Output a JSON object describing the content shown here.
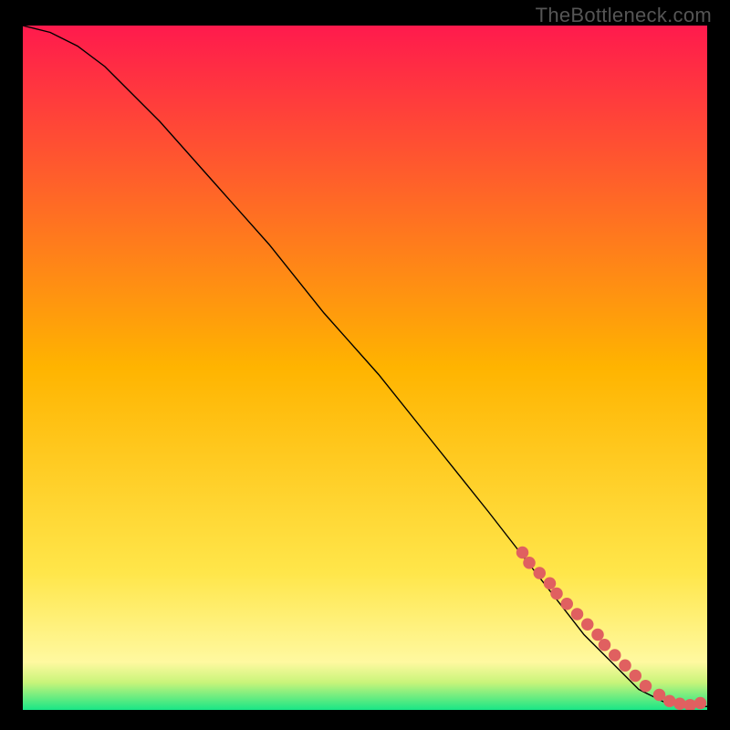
{
  "watermark": "TheBottleneck.com",
  "chart_data": {
    "type": "line",
    "title": "",
    "xlabel": "",
    "ylabel": "",
    "xlim": [
      0,
      100
    ],
    "ylim": [
      0,
      100
    ],
    "background_gradient": {
      "stops": [
        {
          "t": 0.0,
          "color": "#ff1a4d"
        },
        {
          "t": 0.5,
          "color": "#ffb400"
        },
        {
          "t": 0.8,
          "color": "#ffe64a"
        },
        {
          "t": 0.93,
          "color": "#fff9a0"
        },
        {
          "t": 0.96,
          "color": "#c8f47a"
        },
        {
          "t": 1.0,
          "color": "#19e686"
        }
      ]
    },
    "series": [
      {
        "name": "curve",
        "type": "line",
        "color": "#000000",
        "x": [
          0,
          4,
          8,
          12,
          16,
          20,
          28,
          36,
          44,
          52,
          60,
          68,
          75,
          82,
          86,
          90,
          94,
          97,
          100
        ],
        "y": [
          100,
          99,
          97,
          94,
          90,
          86,
          77,
          68,
          58,
          49,
          39,
          29,
          20,
          11,
          7,
          3,
          1,
          0.5,
          0.5
        ]
      },
      {
        "name": "dots",
        "type": "scatter",
        "color": "#e06060",
        "x": [
          73,
          74,
          75.5,
          77,
          78,
          79.5,
          81,
          82.5,
          84,
          85,
          86.5,
          88,
          89.5,
          91,
          93,
          94.5,
          96,
          97.5,
          99
        ],
        "y": [
          23,
          21.5,
          20,
          18.5,
          17,
          15.5,
          14,
          12.5,
          11,
          9.5,
          8,
          6.5,
          5,
          3.5,
          2.2,
          1.3,
          0.9,
          0.7,
          1.0
        ]
      }
    ]
  }
}
